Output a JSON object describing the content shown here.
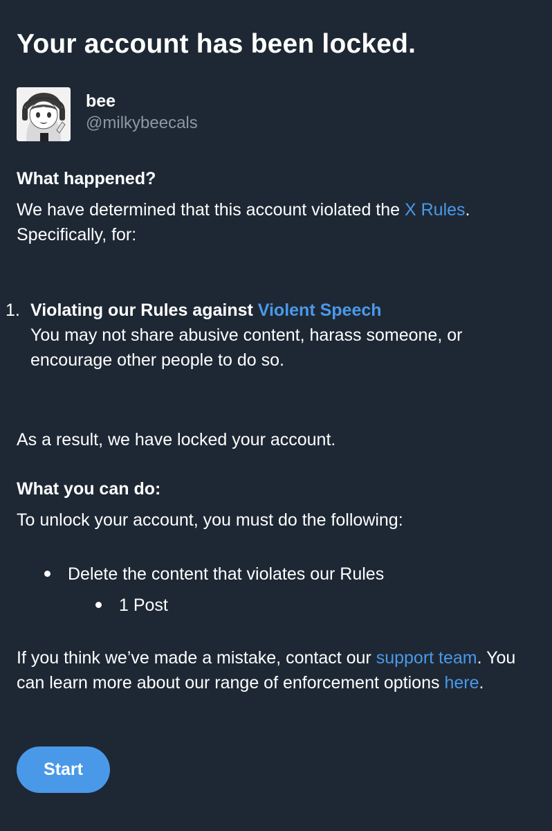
{
  "title": "Your account has been locked.",
  "profile": {
    "display_name": "bee",
    "handle": "@milkybeecals",
    "avatar_icon": "anime-avatar-icon"
  },
  "what_happened": {
    "heading": "What happened?",
    "text_before_link": "We have determined that this account violated the ",
    "rules_link": "X Rules",
    "text_after_link": ". Specifically, for:"
  },
  "violations": [
    {
      "number": "1.",
      "title_prefix": "Violating our Rules against ",
      "title_link": "Violent Speech",
      "description": "You may not share abusive content, harass someone, or encourage other people to do so."
    }
  ],
  "result_text": "As a result, we have locked your account.",
  "what_you_can_do": {
    "heading": "What you can do:",
    "text": "To unlock your account, you must do the following:",
    "steps": [
      {
        "label": "Delete the content that violates our Rules",
        "sub_items": [
          "1 Post"
        ]
      }
    ]
  },
  "footer": {
    "text_before_support": "If you think we’ve made a mistake, contact our ",
    "support_link": "support team",
    "text_middle": ". You can learn more about our range of enforcement options ",
    "here_link": "here",
    "text_end": "."
  },
  "start_button": "Start",
  "colors": {
    "background": "#1e2834",
    "link": "#4a99e9",
    "muted": "#8b98a5",
    "button": "#4a99e9"
  }
}
